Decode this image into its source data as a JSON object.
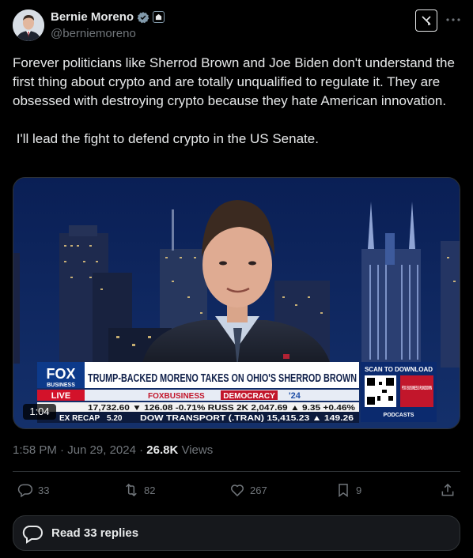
{
  "author": {
    "name": "Bernie Moreno",
    "handle": "@berniemoreno",
    "avatar_icon": "profile-photo"
  },
  "tweet": {
    "paragraph1": "Forever politicians like Sherrod Brown and Joe Biden don't understand the first thing about crypto and are totally unqualified to regulate it. They are obsessed with destroying crypto because they hate American innovation.",
    "paragraph2": " I'll lead the fight to defend crypto in the US Senate."
  },
  "video": {
    "duration": "1:04",
    "lower_third": {
      "network_top": "FOX",
      "network_bottom": "BUSINESS",
      "live_label": "LIVE",
      "headline": "TRUMP-BACKED MORENO TAKES ON OHIO'S SHERROD BROWN",
      "subhead_left": "FOXBUSINESS",
      "subhead_right": "DEMOCRACY",
      "subhead_year": "'24",
      "scan_label": "SCAN TO DOWNLOAD",
      "podcast_label": "FOX BUSINESS RUNDOWN",
      "podcasts_footer": "PODCASTS",
      "ticker_row1": "17,732.60 ▼ 126.08 -0.71%   RUSS 2K   2,047.69 ▲ 9.35 +0.46%",
      "ticker_left": "EX RECAP",
      "ticker_left_value": "5.20",
      "ticker_row2": "DOW TRANSPORT (.TRAN)  15,415.23 ▲ 149.26"
    }
  },
  "meta": {
    "time": "1:58 PM · Jun 29, 2024",
    "views_count": "26.8K",
    "views_label": "Views"
  },
  "actions": {
    "replies": "33",
    "reposts": "82",
    "likes": "267",
    "bookmarks": "9"
  },
  "read_replies_label": "Read 33 replies",
  "colors": {
    "background": "#000000",
    "text": "#e7e9ea",
    "muted": "#71767b",
    "verified": "#1d9bf0",
    "border": "#2f3336"
  }
}
